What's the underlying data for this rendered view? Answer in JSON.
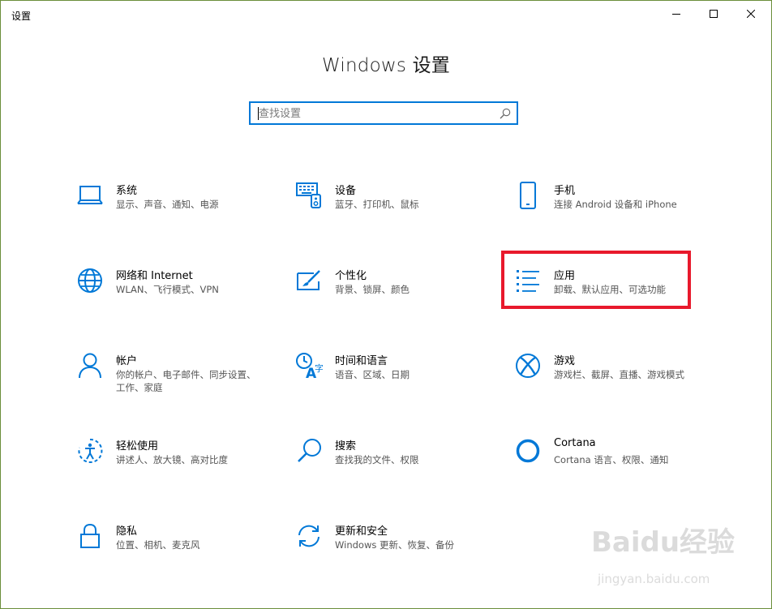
{
  "window": {
    "title": "设置",
    "controls": {
      "minimize": "minimize-icon",
      "maximize": "maximize-icon",
      "close": "close-icon"
    }
  },
  "header": {
    "title": "Windows 设置"
  },
  "search": {
    "value": "",
    "placeholder": "查找设置",
    "icon": "search-icon"
  },
  "tiles": [
    {
      "name": "系统",
      "desc": "显示、声音、通知、电源",
      "icon": "laptop-icon"
    },
    {
      "name": "设备",
      "desc": "蓝牙、打印机、鼠标",
      "icon": "keyboard-icon"
    },
    {
      "name": "手机",
      "desc": "连接 Android 设备和 iPhone",
      "icon": "phone-icon"
    },
    {
      "name": "网络和 Internet",
      "desc": "WLAN、飞行模式、VPN",
      "icon": "globe-icon"
    },
    {
      "name": "个性化",
      "desc": "背景、锁屏、颜色",
      "icon": "paint-icon"
    },
    {
      "name": "应用",
      "desc": "卸载、默认应用、可选功能",
      "icon": "apps-list-icon"
    },
    {
      "name": "帐户",
      "desc": "你的帐户、电子邮件、同步设置、工作、家庭",
      "icon": "person-icon"
    },
    {
      "name": "时间和语言",
      "desc": "语音、区域、日期",
      "icon": "time-language-icon"
    },
    {
      "name": "游戏",
      "desc": "游戏栏、截屏、直播、游戏模式",
      "icon": "xbox-icon"
    },
    {
      "name": "轻松使用",
      "desc": "讲述人、放大镜、高对比度",
      "icon": "ease-of-access-icon"
    },
    {
      "name": "搜索",
      "desc": "查找我的文件、权限",
      "icon": "magnifier-icon"
    },
    {
      "name": "Cortana",
      "desc": "Cortana 语言、权限、通知",
      "icon": "cortana-icon"
    },
    {
      "name": "隐私",
      "desc": "位置、相机、麦克风",
      "icon": "lock-icon"
    },
    {
      "name": "更新和安全",
      "desc": "Windows 更新、恢复、备份",
      "icon": "sync-icon"
    }
  ],
  "colors": {
    "accent": "#0078d7",
    "highlight": "#e8192c"
  },
  "watermark": {
    "logo": "Baidu经验",
    "url": "jingyan.baidu.com"
  }
}
